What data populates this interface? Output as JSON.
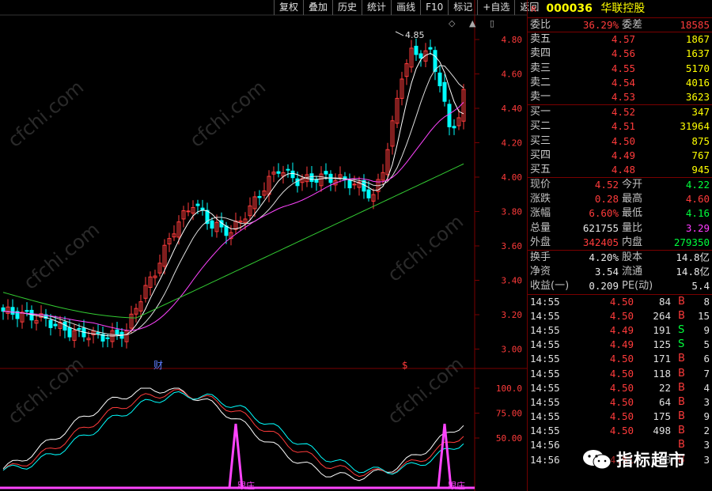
{
  "toolbar": {
    "items": [
      "复权",
      "叠加",
      "历史",
      "统计",
      "画线",
      "F10",
      "标记",
      "+自选",
      "返回"
    ]
  },
  "top_icons": [
    "◇",
    "▲",
    "▯"
  ],
  "stock": {
    "marker": "R",
    "code": "000036",
    "name": "华联控股"
  },
  "weibi": {
    "label1": "委比",
    "value1": "36.29%",
    "label2": "委差",
    "value2": "18585"
  },
  "sell": [
    {
      "label": "卖五",
      "price": "4.57",
      "vol": "1867"
    },
    {
      "label": "卖四",
      "price": "4.56",
      "vol": "1637"
    },
    {
      "label": "卖三",
      "price": "4.55",
      "vol": "5170"
    },
    {
      "label": "卖二",
      "price": "4.54",
      "vol": "4016"
    },
    {
      "label": "卖一",
      "price": "4.53",
      "vol": "3623"
    }
  ],
  "buy": [
    {
      "label": "买一",
      "price": "4.52",
      "vol": "347"
    },
    {
      "label": "买二",
      "price": "4.51",
      "vol": "31964"
    },
    {
      "label": "买三",
      "price": "4.50",
      "vol": "875"
    },
    {
      "label": "买四",
      "price": "4.49",
      "vol": "767"
    },
    {
      "label": "买五",
      "price": "4.48",
      "vol": "945"
    }
  ],
  "stats1": [
    {
      "l1": "现价",
      "v1": "4.52",
      "c1": "red",
      "l2": "今开",
      "v2": "4.22",
      "c2": "grn"
    },
    {
      "l1": "涨跌",
      "v1": "0.28",
      "c1": "red",
      "l2": "最高",
      "v2": "4.60",
      "c2": "red"
    },
    {
      "l1": "涨幅",
      "v1": "6.60%",
      "c1": "red",
      "l2": "最低",
      "v2": "4.16",
      "c2": "grn"
    },
    {
      "l1": "总量",
      "v1": "621755",
      "c1": "wht",
      "l2": "量比",
      "v2": "3.29",
      "c2": "mag"
    },
    {
      "l1": "外盘",
      "v1": "342405",
      "c1": "red",
      "l2": "内盘",
      "v2": "279350",
      "c2": "grn"
    }
  ],
  "stats2": [
    {
      "l1": "换手",
      "v1": "4.20%",
      "l2": "股本",
      "v2": "14.8亿"
    },
    {
      "l1": "净资",
      "v1": "3.54",
      "l2": "流通",
      "v2": "14.8亿"
    },
    {
      "l1": "收益(一)",
      "v1": "0.209",
      "l2": "PE(动)",
      "v2": "5.4"
    }
  ],
  "ticks": [
    {
      "time": "14:55",
      "price": "4.50",
      "vol": "84",
      "side": "B",
      "num": "8"
    },
    {
      "time": "14:55",
      "price": "4.50",
      "vol": "264",
      "side": "B",
      "num": "15"
    },
    {
      "time": "14:55",
      "price": "4.49",
      "vol": "191",
      "side": "S",
      "num": "9"
    },
    {
      "time": "14:55",
      "price": "4.49",
      "vol": "125",
      "side": "S",
      "num": "5"
    },
    {
      "time": "14:55",
      "price": "4.50",
      "vol": "171",
      "side": "B",
      "num": "6"
    },
    {
      "time": "14:55",
      "price": "4.50",
      "vol": "118",
      "side": "B",
      "num": "7"
    },
    {
      "time": "14:55",
      "price": "4.50",
      "vol": "22",
      "side": "B",
      "num": "4"
    },
    {
      "time": "14:55",
      "price": "4.50",
      "vol": "64",
      "side": "B",
      "num": "3"
    },
    {
      "time": "14:55",
      "price": "4.50",
      "vol": "175",
      "side": "B",
      "num": "9"
    },
    {
      "time": "14:55",
      "price": "4.50",
      "vol": "498",
      "side": "B",
      "num": "2"
    },
    {
      "time": "14:56",
      "price": "",
      "vol": "",
      "side": "B",
      "num": "3"
    },
    {
      "time": "14:56",
      "price": "4.51",
      "vol": "48",
      "side": "B",
      "num": "3"
    }
  ],
  "price_axis": [
    "4.80",
    "4.60",
    "4.40",
    "4.20",
    "4.00",
    "3.80",
    "3.60",
    "3.40",
    "3.20",
    "3.00"
  ],
  "osc_axis": [
    "100.0",
    "75.00",
    "50.00"
  ],
  "peak_label": "4.85",
  "markers": {
    "cai": "财",
    "s": "$"
  },
  "gen_labels": [
    "跟庄",
    "跟庄"
  ],
  "watermark": "cfchi.com",
  "badge_text": "指标超市",
  "colors": {
    "up": "#ff3b3b",
    "down": "#00ffff",
    "ma_white": "#ffffff",
    "ma_magenta": "#ff44ff",
    "ma_green": "#33cc33",
    "grid": "#7a0000"
  }
}
